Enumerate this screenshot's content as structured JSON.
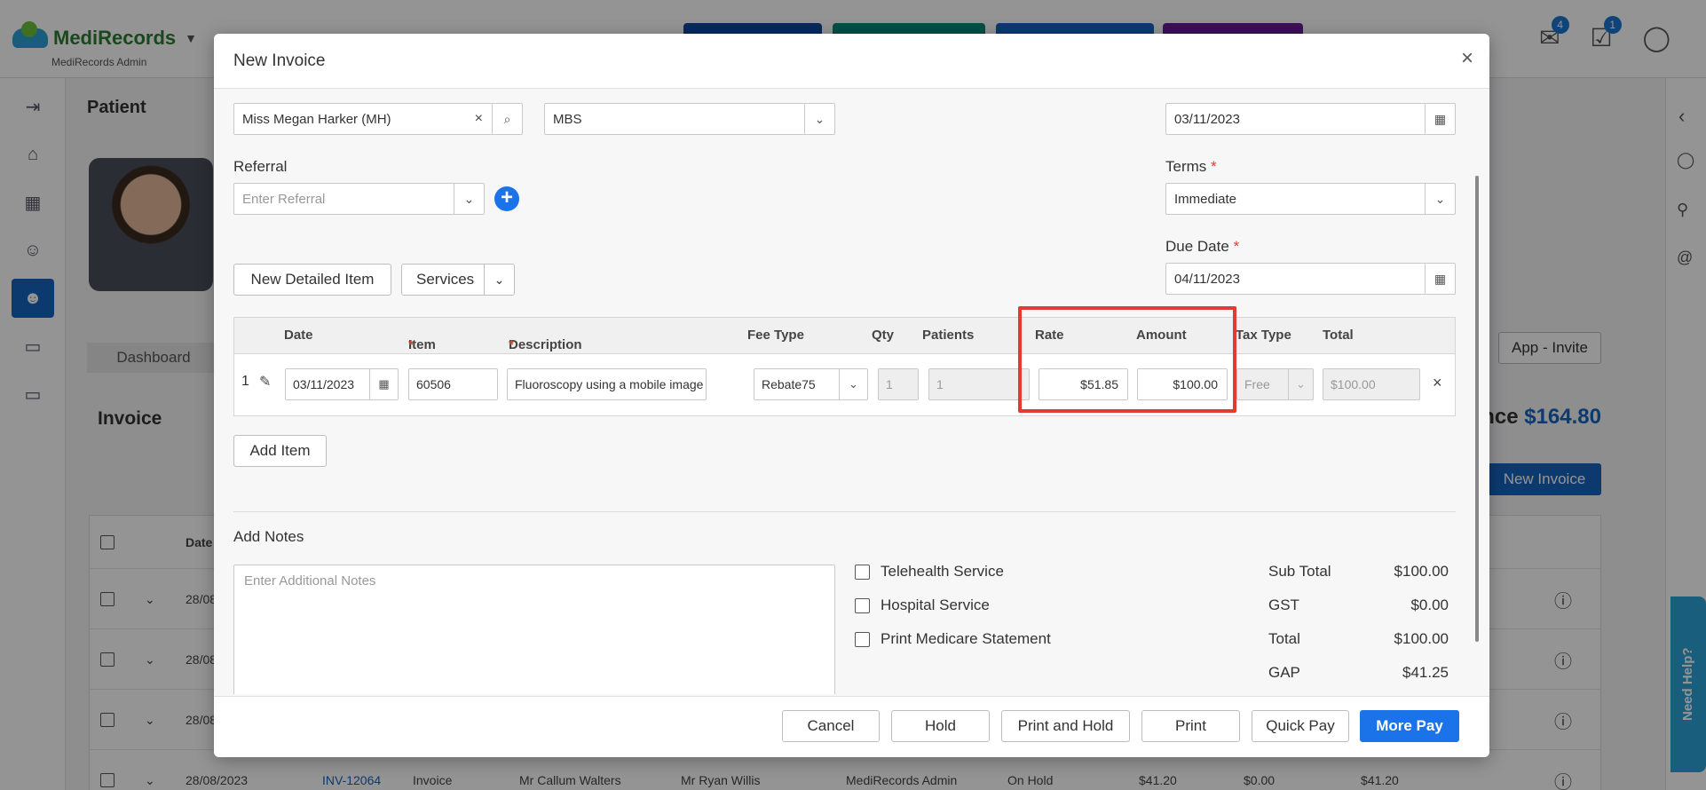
{
  "app": {
    "brand": "MediRecords",
    "brand_sub": "MediRecords Admin",
    "badges": {
      "mail": "4",
      "tasks": "1"
    }
  },
  "background": {
    "patient_header": "Patient",
    "dashboard_tab": "Dashboard",
    "invoice_header": "Invoice",
    "balance_label": "nce",
    "balance_value": "$164.80",
    "new_invoice": "New Invoice",
    "app_invite": "App - Invite",
    "need_help": "Need Help?",
    "table_col_date": "Date",
    "rows": [
      {
        "date": "28/08"
      },
      {
        "date": "28/08"
      },
      {
        "date": "28/08"
      },
      {
        "date": "28/08/2023",
        "invoice_no": "INV-12064",
        "type": "Invoice",
        "patient": "Mr Callum Walters",
        "provider": "Mr Ryan Willis",
        "created_by": "MediRecords Admin",
        "status": "On Hold",
        "amount": "$41.20",
        "paid": "$0.00",
        "balance": "$41.20"
      }
    ]
  },
  "modal": {
    "title": "New Invoice",
    "patient_value": "Miss Megan Harker (MH)",
    "billing_type": "MBS",
    "invoice_date": "03/11/2023",
    "referral_label": "Referral",
    "referral_placeholder": "Enter Referral",
    "terms_label": "Terms",
    "terms_value": "Immediate",
    "due_date_label": "Due Date",
    "due_date_value": "04/11/2023",
    "btn_new_detailed": "New Detailed Item",
    "btn_services": "Services",
    "btn_add_item": "Add Item",
    "required_marker": "*",
    "table": {
      "headers": {
        "date": "Date",
        "item": "Item",
        "description": "Description",
        "fee_type": "Fee Type",
        "qty": "Qty",
        "patients": "Patients",
        "rate": "Rate",
        "amount": "Amount",
        "tax_type": "Tax Type",
        "total": "Total"
      },
      "rows": [
        {
          "num": "1",
          "date": "03/11/2023",
          "item": "60506",
          "description": "Fluoroscopy using a mobile image int...",
          "fee_type": "Rebate75",
          "qty": "1",
          "patients": "1",
          "rate": "$51.85",
          "amount": "$100.00",
          "tax_type": "Free",
          "total": "$100.00"
        }
      ]
    },
    "notes_label": "Add Notes",
    "notes_placeholder": "Enter Additional Notes",
    "checkboxes": [
      "Telehealth Service",
      "Hospital Service",
      "Print Medicare Statement"
    ],
    "summary": [
      {
        "label": "Sub Total",
        "value": "$100.00"
      },
      {
        "label": "GST",
        "value": "$0.00"
      },
      {
        "label": "Total",
        "value": "$100.00"
      },
      {
        "label": "GAP",
        "value": "$41.25"
      }
    ],
    "footer": {
      "cancel": "Cancel",
      "hold": "Hold",
      "print_and_hold": "Print and Hold",
      "print": "Print",
      "quick_pay": "Quick Pay",
      "more_pay": "More Pay"
    }
  },
  "colors": {
    "primary": "#1a73e8",
    "highlight": "#e53935",
    "brand_blue": "#1565c0"
  }
}
